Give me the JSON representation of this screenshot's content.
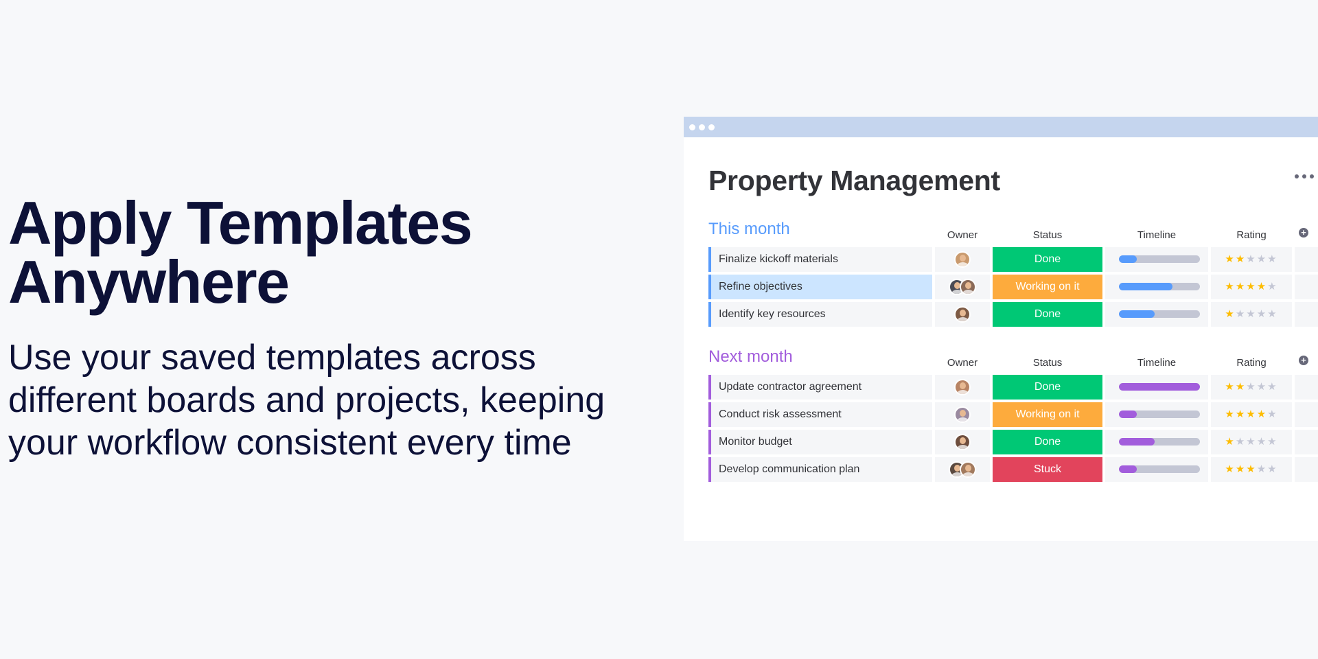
{
  "hero": {
    "title_line1": "Apply Templates",
    "title_line2": "Anywhere",
    "subtitle_line1": "Use your saved templates across",
    "subtitle_line2": "different boards and projects, keeping",
    "subtitle_line3": "your workflow consistent every time"
  },
  "board": {
    "title": "Property Management",
    "columns": {
      "owner": "Owner",
      "status": "Status",
      "timeline": "Timeline",
      "rating": "Rating"
    },
    "groups": [
      {
        "title": "This month",
        "color": "#579bfc",
        "items": [
          {
            "name": "Finalize kickoff materials",
            "avatars": [
              "#c99a6e"
            ],
            "status": "Done",
            "status_color": "#00c875",
            "timeline_progress": 0.22,
            "rating": 2,
            "selected": false
          },
          {
            "name": "Refine objectives",
            "avatars": [
              "#4b4b55",
              "#8a6a58"
            ],
            "status": "Working on it",
            "status_color": "#fdab3d",
            "timeline_progress": 0.66,
            "rating": 4,
            "selected": true
          },
          {
            "name": "Identify key resources",
            "avatars": [
              "#7d5a44"
            ],
            "status": "Done",
            "status_color": "#00c875",
            "timeline_progress": 0.44,
            "rating": 1,
            "selected": false
          }
        ]
      },
      {
        "title": "Next month",
        "color": "#a25ddc",
        "items": [
          {
            "name": "Update contractor agreement",
            "avatars": [
              "#b88464"
            ],
            "status": "Done",
            "status_color": "#00c875",
            "timeline_progress": 1.0,
            "rating": 2,
            "selected": false
          },
          {
            "name": "Conduct risk assessment",
            "avatars": [
              "#9a8aa0"
            ],
            "status": "Working on it",
            "status_color": "#fdab3d",
            "timeline_progress": 0.22,
            "rating": 4,
            "selected": false
          },
          {
            "name": "Monitor budget",
            "avatars": [
              "#6e4e3e"
            ],
            "status": "Done",
            "status_color": "#00c875",
            "timeline_progress": 0.44,
            "rating": 1,
            "selected": false
          },
          {
            "name": "Develop communication plan",
            "avatars": [
              "#5b4a40",
              "#a27a5e"
            ],
            "status": "Stuck",
            "status_color": "#e2445c",
            "timeline_progress": 0.22,
            "rating": 3,
            "selected": false
          }
        ]
      }
    ]
  },
  "icons": {
    "more": "more-horizontal-icon",
    "add_column": "add-column-icon"
  }
}
